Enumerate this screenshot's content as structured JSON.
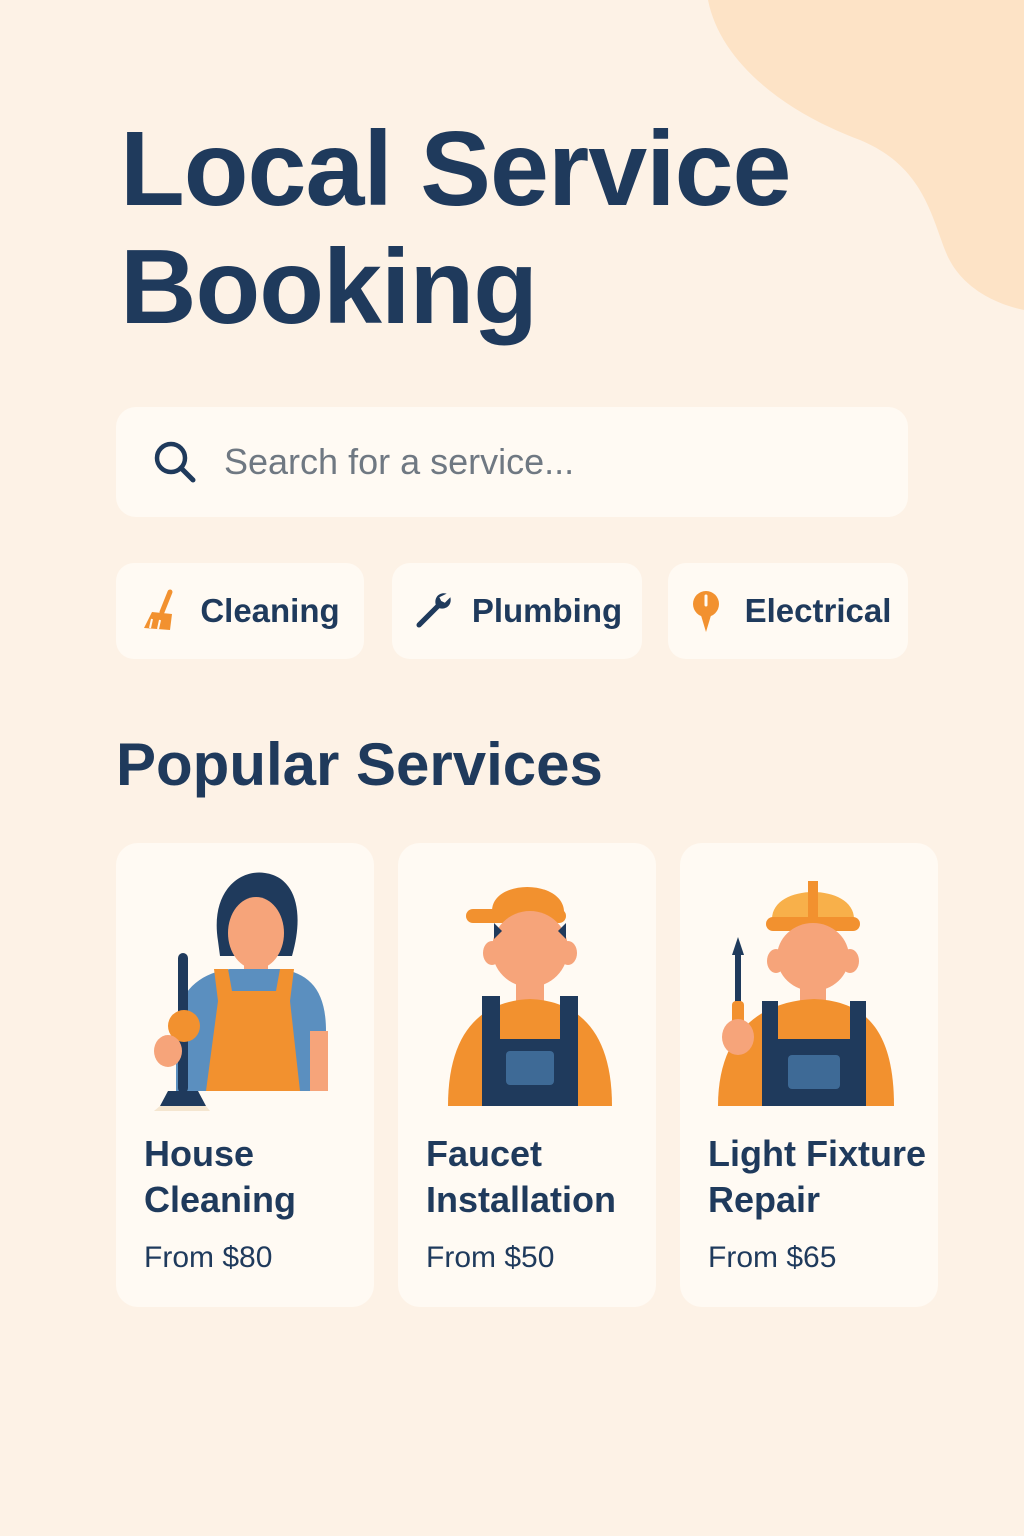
{
  "header": {
    "title_line1": "Local Service",
    "title_line2": "Booking"
  },
  "search": {
    "placeholder": "Search for a service...",
    "icon": "search-icon"
  },
  "categories": [
    {
      "label": "Cleaning",
      "icon": "broom-icon"
    },
    {
      "label": "Plumbing",
      "icon": "wrench-icon"
    },
    {
      "label": "Electrical",
      "icon": "electrical-pin-icon"
    }
  ],
  "popular": {
    "title": "Popular Services",
    "services": [
      {
        "name_line1": "House",
        "name_line2": "Cleaning",
        "price": "From $80",
        "illustration": "cleaner-illustration"
      },
      {
        "name_line1": "Faucet",
        "name_line2": "Installation",
        "price": "From $50",
        "illustration": "plumber-illustration"
      },
      {
        "name_line1": "Light Fixture",
        "name_line2": "Repair",
        "price": "From $65",
        "illustration": "electrician-illustration"
      }
    ]
  },
  "colors": {
    "background": "#fdf2e6",
    "card": "#fffaf3",
    "navy": "#1f3a5c",
    "accent_orange": "#f2912f",
    "blob": "#fde3c6"
  }
}
